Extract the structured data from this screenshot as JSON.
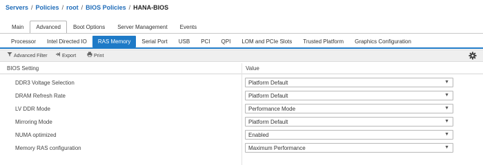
{
  "breadcrumb": {
    "items": [
      "Servers",
      "Policies",
      "root",
      "BIOS Policies",
      "HANA-BIOS"
    ],
    "separator": "/"
  },
  "main_tabs": [
    {
      "label": "Main",
      "active": false
    },
    {
      "label": "Advanced",
      "active": true
    },
    {
      "label": "Boot Options",
      "active": false
    },
    {
      "label": "Server Management",
      "active": false
    },
    {
      "label": "Events",
      "active": false
    }
  ],
  "sub_tabs": [
    {
      "label": "Processor",
      "active": false
    },
    {
      "label": "Intel Directed IO",
      "active": false
    },
    {
      "label": "RAS Memory",
      "active": true
    },
    {
      "label": "Serial Port",
      "active": false
    },
    {
      "label": "USB",
      "active": false
    },
    {
      "label": "PCI",
      "active": false
    },
    {
      "label": "QPI",
      "active": false
    },
    {
      "label": "LOM and PCIe Slots",
      "active": false
    },
    {
      "label": "Trusted Platform",
      "active": false
    },
    {
      "label": "Graphics Configuration",
      "active": false
    }
  ],
  "toolbar": {
    "filter_label": "Advanced Filter",
    "filter_icon": "filter-icon",
    "export_label": "Export",
    "export_icon": "export-icon",
    "print_label": "Print",
    "print_icon": "print-icon",
    "settings_icon": "gear-icon"
  },
  "table": {
    "headers": [
      "BIOS Setting",
      "Value"
    ],
    "rows": [
      {
        "setting": "DDR3 Voltage Selection",
        "value": "Platform Default"
      },
      {
        "setting": "DRAM Refresh Rate",
        "value": "Platform Default"
      },
      {
        "setting": "LV DDR Mode",
        "value": "Performance Mode"
      },
      {
        "setting": "Mirroring Mode",
        "value": "Platform Default"
      },
      {
        "setting": "NUMA optimized",
        "value": "Enabled"
      },
      {
        "setting": "Memory RAS configuration",
        "value": "Maximum Performance"
      }
    ]
  },
  "colors": {
    "accent": "#1e7ac7",
    "link": "#1e6bb8"
  }
}
